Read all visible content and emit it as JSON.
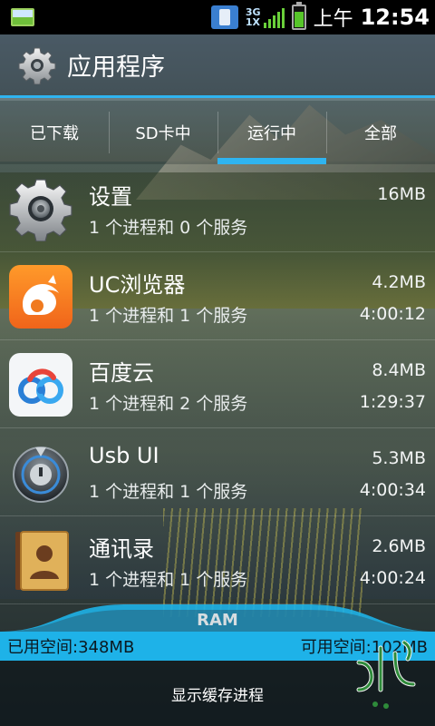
{
  "status_bar": {
    "network_top": "3G",
    "network_bottom": "1X",
    "ampm": "上午",
    "time": "12:54",
    "colors": {
      "signal": "#6ad03a",
      "battery": "#57c52a"
    }
  },
  "header": {
    "title": "应用程序",
    "icon": "settings-gear-icon",
    "accent_color": "#2fb4f0"
  },
  "tabs": [
    {
      "label": "已下载",
      "active": false
    },
    {
      "label": "SD卡中",
      "active": false
    },
    {
      "label": "运行中",
      "active": true
    },
    {
      "label": "全部",
      "active": false
    }
  ],
  "apps": [
    {
      "name": "设置",
      "desc": "1 个进程和 0 个服务",
      "size": "16MB",
      "time": "",
      "icon": "settings-gear-icon"
    },
    {
      "name": "UC浏览器",
      "desc": "1 个进程和 1 个服务",
      "size": "4.2MB",
      "time": "4:00:12",
      "icon": "uc-browser-icon"
    },
    {
      "name": "百度云",
      "desc": "1 个进程和 2 个服务",
      "size": "8.4MB",
      "time": "1:29:37",
      "icon": "baidu-cloud-icon"
    },
    {
      "name": "Usb UI",
      "desc": "1 个进程和 1 个服务",
      "size": "5.3MB",
      "time": "4:00:34",
      "icon": "usb-ui-icon"
    },
    {
      "name": "通讯录",
      "desc": "1 个进程和 1 个服务",
      "size": "2.6MB",
      "time": "4:00:24",
      "icon": "contacts-book-icon"
    }
  ],
  "ram": {
    "label": "RAM",
    "used": "已用空间:348MB",
    "free": "可用空间:102MB",
    "bar_color": "#1eb2e8"
  },
  "footer": {
    "show_cached": "显示缓存进程"
  }
}
